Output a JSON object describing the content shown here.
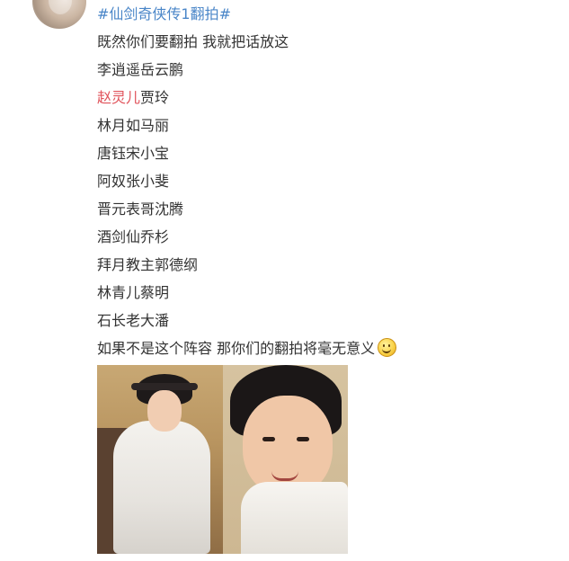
{
  "post": {
    "hashtag_open": "#",
    "hashtag_text": "仙剑奇侠传1翻拍",
    "hashtag_close": "#",
    "lines": [
      "既然你们要翻拍 我就把话放这",
      "李逍遥岳云鹏"
    ],
    "red_line": {
      "red_part": "赵灵儿",
      "rest": "贾玲"
    },
    "more_lines": [
      "林月如马丽",
      "唐钰宋小宝",
      "阿奴张小斐",
      "晋元表哥沈腾",
      "酒剑仙乔杉",
      "拜月教主郭德纲",
      "林青儿蔡明",
      "石长老大潘"
    ],
    "closing_line": "如果不是这个阵容 那你们的翻拍将毫无意义",
    "emoji_icon": "smile-emoji-icon"
  },
  "colors": {
    "hashtag": "#4a86c8",
    "highlight_name": "#e0525a",
    "body_text": "#333333"
  }
}
